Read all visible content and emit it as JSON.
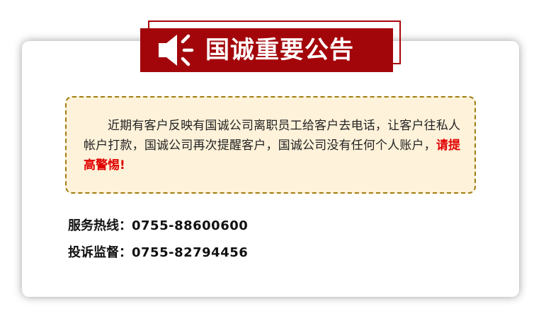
{
  "banner": {
    "title": "国诚重要公告",
    "icon": "megaphone-icon",
    "background_color": "#a3060a"
  },
  "notice": {
    "body": "近期有客户反映有国诚公司离职员工给客户去电话，让客户往私人帐户打款，国诚公司再次提醒客户，国诚公司没有任何个人账户，",
    "warning": "请提高警惕!",
    "warning_color": "#e00000",
    "box_background": "#fef2da",
    "border_color": "#a07d10"
  },
  "contacts": [
    {
      "label": "服务热线：",
      "number": "0755-88600600"
    },
    {
      "label": "投诉监督：",
      "number": "0755-82794456"
    }
  ]
}
